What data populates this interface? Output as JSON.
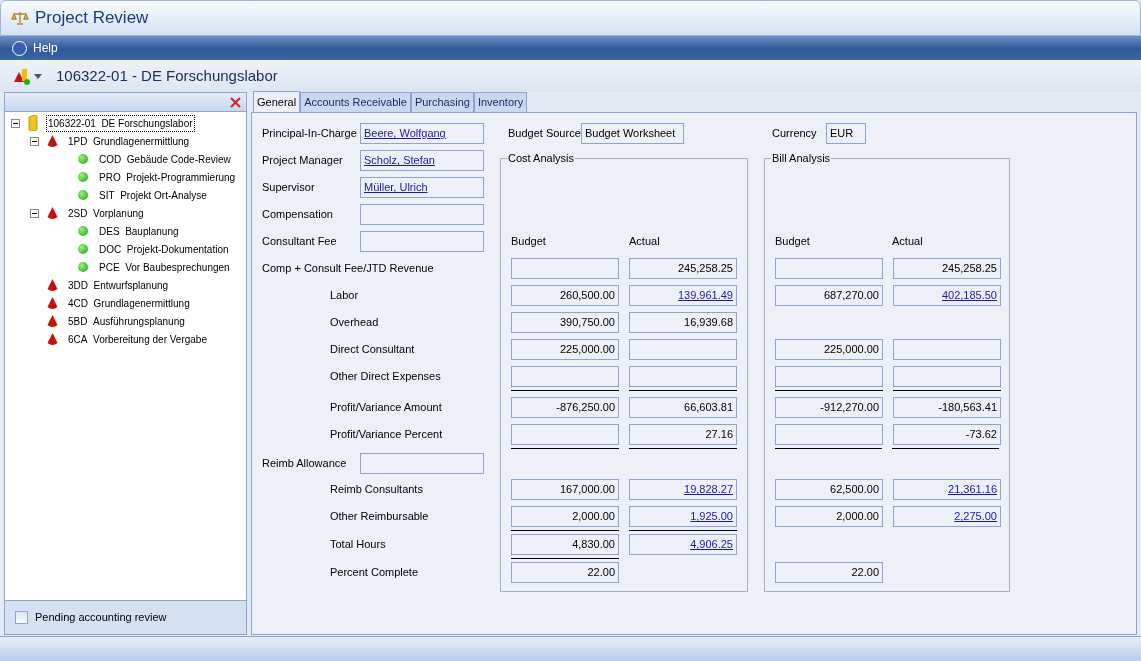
{
  "window": {
    "title": "Project Review"
  },
  "menu": [
    {
      "label": "Help"
    }
  ],
  "project_header": {
    "title": "106322-01 - DE Forschungslabor"
  },
  "tree": [
    {
      "code": "106322-01",
      "label": "DE Forschungslabor",
      "expanded": true,
      "selected": true,
      "children": [
        {
          "code": "1PD",
          "label": "Grundlagenermittlung",
          "expanded": true,
          "selected": false,
          "children": [
            {
              "code": "COD",
              "label": "Gebäude Code-Review",
              "selected": false
            },
            {
              "code": "PRO",
              "label": "Projekt-Programmierung",
              "selected": false
            },
            {
              "code": "SIT",
              "label": "Projekt Ort-Analyse",
              "selected": false
            }
          ]
        },
        {
          "code": "2SD",
          "label": "Vorplanung",
          "expanded": true,
          "selected": false,
          "children": [
            {
              "code": "DES",
              "label": "Bauplanung",
              "selected": false
            },
            {
              "code": "DOC",
              "label": "Projekt-Dokumentation",
              "selected": false
            },
            {
              "code": "PCE",
              "label": "Vor Baubesprechungen",
              "selected": false
            }
          ]
        },
        {
          "code": "3DD",
          "label": "Entwurfsplanung",
          "selected": false
        },
        {
          "code": "4CD",
          "label": "Grundlagenermittlung",
          "selected": false
        },
        {
          "code": "5BD",
          "label": "Ausführungsplanung",
          "selected": false
        },
        {
          "code": "6CA",
          "label": "Vorbereitung der Vergabe",
          "selected": false
        }
      ]
    }
  ],
  "pending_review": {
    "label": "Pending accounting review",
    "checked": false
  },
  "tabs": [
    {
      "label": "General",
      "selected": true
    },
    {
      "label": "Accounts Receivable",
      "selected": false
    },
    {
      "label": "Purchasing",
      "selected": false
    },
    {
      "label": "Inventory",
      "selected": false
    }
  ],
  "budget_source": {
    "label": "Budget Source",
    "value": "Budget Worksheet"
  },
  "currency": {
    "label": "Currency",
    "value": "EUR"
  },
  "cost_analysis": {
    "title": "Cost Analysis",
    "columns": [
      "Budget",
      "Actual"
    ]
  },
  "bill_analysis": {
    "title": "Bill Analysis",
    "columns": [
      "Budget",
      "Actual"
    ]
  },
  "rows": [
    {
      "label": "Principal-In-Charge",
      "field": {
        "kind": "value",
        "value": "Beere, Wolfgang",
        "link": true
      }
    },
    {
      "label": "Project Manager",
      "field": {
        "kind": "value",
        "value": "Scholz, Stefan",
        "link": true
      }
    },
    {
      "label": "Supervisor",
      "field": {
        "kind": "value",
        "value": "Müller, Ulrich",
        "link": true
      }
    },
    {
      "label": "Compensation",
      "field": {
        "kind": "blank"
      }
    },
    {
      "label": "Consultant Fee",
      "field": {
        "kind": "blank"
      }
    },
    {
      "label": "Comp + Consult Fee/JTD Revenue",
      "cost": [
        {
          "kind": "blank"
        },
        {
          "kind": "value",
          "value": "245,258.25",
          "link": false
        }
      ],
      "bill": [
        {
          "kind": "blank"
        },
        {
          "kind": "value",
          "value": "245,258.25",
          "link": false
        }
      ],
      "children": [
        {
          "label": "Labor",
          "cost": [
            {
              "kind": "value",
              "value": "260,500.00",
              "link": false
            },
            {
              "kind": "value",
              "value": "139,961.49",
              "link": true
            }
          ],
          "bill": [
            {
              "kind": "value",
              "value": "687,270.00",
              "link": false
            },
            {
              "kind": "value",
              "value": "402,185.50",
              "link": true
            }
          ]
        },
        {
          "label": "Overhead",
          "cost": [
            {
              "kind": "value",
              "value": "390,750.00",
              "link": false
            },
            {
              "kind": "value",
              "value": "16,939.68",
              "link": false
            }
          ]
        },
        {
          "label": "Direct Consultant",
          "cost": [
            {
              "kind": "value",
              "value": "225,000.00",
              "link": false
            },
            {
              "kind": "blank"
            }
          ],
          "bill": [
            {
              "kind": "value",
              "value": "225,000.00",
              "link": false
            },
            {
              "kind": "blank"
            }
          ]
        },
        {
          "label": "Other Direct Expenses",
          "cost": [
            {
              "kind": "blank"
            },
            {
              "kind": "blank"
            }
          ],
          "bill": [
            {
              "kind": "blank"
            },
            {
              "kind": "blank"
            }
          ]
        },
        {
          "label": "Profit/Variance Amount",
          "cost": [
            {
              "kind": "value",
              "value": "-876,250.00",
              "link": false
            },
            {
              "kind": "value",
              "value": "66,603.81",
              "link": false
            }
          ],
          "bill": [
            {
              "kind": "value",
              "value": "-912,270.00",
              "link": false
            },
            {
              "kind": "value",
              "value": "-180,563.41",
              "link": false
            }
          ]
        },
        {
          "label": "Profit/Variance Percent",
          "cost": [
            {
              "kind": "blank"
            },
            {
              "kind": "value",
              "value": "27.16",
              "link": false
            }
          ],
          "bill": [
            {
              "kind": "blank"
            },
            {
              "kind": "value",
              "value": "-73.62",
              "link": false
            }
          ]
        }
      ]
    },
    {
      "label": "Reimb Allowance",
      "field": {
        "kind": "blank"
      },
      "children": [
        {
          "label": "Reimb Consultants",
          "cost": [
            {
              "kind": "value",
              "value": "167,000.00",
              "link": false
            },
            {
              "kind": "value",
              "value": "19,828.27",
              "link": true
            }
          ],
          "bill": [
            {
              "kind": "value",
              "value": "62,500.00",
              "link": false
            },
            {
              "kind": "value",
              "value": "21,361.16",
              "link": true
            }
          ]
        },
        {
          "label": "Other Reimbursable",
          "cost": [
            {
              "kind": "value",
              "value": "2,000.00",
              "link": false
            },
            {
              "kind": "value",
              "value": "1,925.00",
              "link": true
            }
          ],
          "bill": [
            {
              "kind": "value",
              "value": "2,000.00",
              "link": false
            },
            {
              "kind": "value",
              "value": "2,275.00",
              "link": true
            }
          ]
        },
        {
          "label": "Total Hours",
          "cost": [
            {
              "kind": "value",
              "value": "4,830.00",
              "link": false
            },
            {
              "kind": "value",
              "value": "4,906.25",
              "link": true
            }
          ]
        },
        {
          "label": "Percent Complete",
          "cost": [
            {
              "kind": "value",
              "value": "22.00",
              "link": false
            }
          ],
          "bill": [
            {
              "kind": "value",
              "value": "22.00",
              "link": false
            }
          ]
        }
      ]
    }
  ]
}
